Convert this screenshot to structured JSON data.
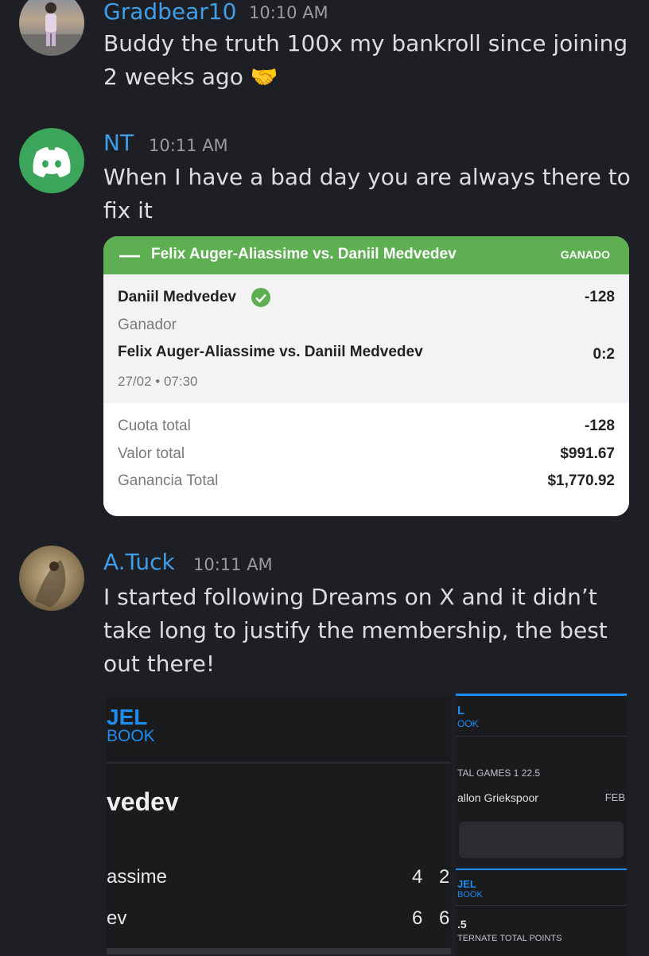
{
  "messages": [
    {
      "author": "Gradbear10",
      "time": "10:10 AM",
      "text": "Buddy the truth 100x my bankroll since joining 2 weeks ago 🤝"
    },
    {
      "author": "NT",
      "time": "10:11 AM",
      "text": "When I have a bad day you are always there to fix it"
    },
    {
      "author": "A.Tuck",
      "time": "10:11 AM",
      "text": "I started following Dreams on X and it didn’t take long to justify the membership, the best out there!"
    }
  ],
  "bet_card": {
    "match": "Felix Auger-Aliassime vs. Daniil Medvedev",
    "status": "GANADO",
    "selection": "Daniil Medvedev",
    "odds": "-128",
    "market": "Ganador",
    "event": "Felix Auger-Aliassime vs. Daniil Medvedev",
    "score": "0:2",
    "datetime": "27/02 • 07:30",
    "rows": [
      {
        "label": "Cuota total",
        "value": "-128"
      },
      {
        "label": "Valor total",
        "value": "$991.67"
      },
      {
        "label": "Ganancia Total",
        "value": "$1,770.92"
      }
    ]
  },
  "attachments": {
    "left": {
      "logo_top": "JEL",
      "logo_bottom": "BOOK",
      "player": "vedev",
      "row1_name": "assime",
      "row1_s1": "4",
      "row1_s2": "2",
      "row2_name": "ev",
      "row2_s1": "6",
      "row2_s2": "6"
    },
    "right_top": {
      "logo_top": "L",
      "logo_bottom": "OOK",
      "market": "TAL GAMES 1 22.5",
      "event": "allon Griekspoor",
      "date": "FEB"
    },
    "right_bottom": {
      "logo_top": "JEL",
      "logo_bottom": "BOOK",
      "line": ".5",
      "market": "TERNATE TOTAL POINTS"
    }
  },
  "colors": {
    "background": "#1e1f24",
    "username": "#3f9ee8",
    "discord_avatar": "#3ba55c",
    "bet_header": "#5eaf52",
    "fanduel_blue": "#1f8cf0"
  }
}
